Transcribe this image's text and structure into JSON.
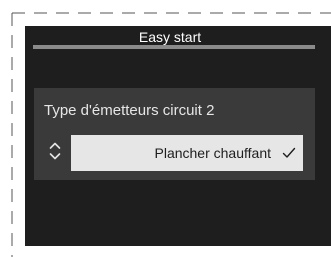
{
  "header": {
    "title": "Easy start"
  },
  "setting": {
    "label": "Type d'émetteurs circuit 2",
    "value": "Plancher chauffant",
    "icons": {
      "selector": "up-down-arrows-icon",
      "confirm": "check-icon"
    }
  },
  "colors": {
    "screen_background": "#1e1e1e",
    "panel_background": "#3a3a3a",
    "value_background": "#e6e6e6",
    "title_bar": "#8a8a8a",
    "text_light": "#ffffff"
  }
}
